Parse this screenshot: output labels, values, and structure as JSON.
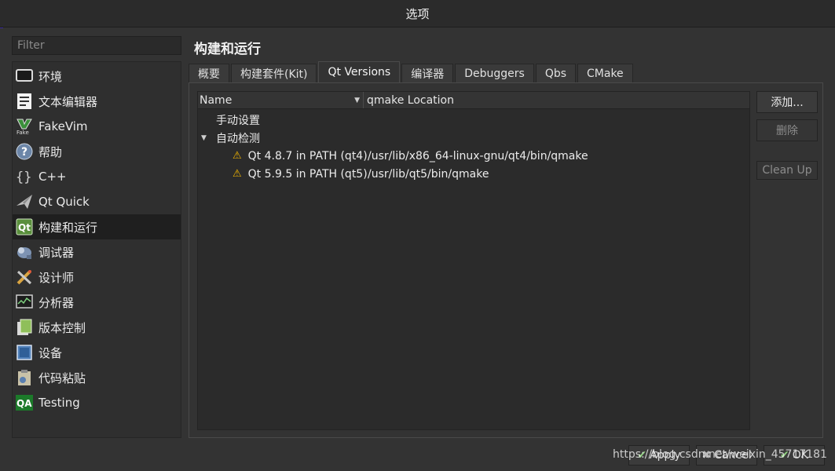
{
  "window": {
    "title": "选项"
  },
  "filter": {
    "placeholder": "Filter"
  },
  "sidebar": {
    "items": [
      {
        "label": "环境",
        "icon": "monitor-icon"
      },
      {
        "label": "文本编辑器",
        "icon": "text-editor-icon"
      },
      {
        "label": "FakeVim",
        "icon": "fakevim-icon"
      },
      {
        "label": "帮助",
        "icon": "help-icon"
      },
      {
        "label": "C++",
        "icon": "braces-icon"
      },
      {
        "label": "Qt Quick",
        "icon": "qt-quick-icon"
      },
      {
        "label": "构建和运行",
        "icon": "build-run-icon",
        "active": true
      },
      {
        "label": "调试器",
        "icon": "debugger-icon"
      },
      {
        "label": "设计师",
        "icon": "designer-icon"
      },
      {
        "label": "分析器",
        "icon": "analyzer-icon"
      },
      {
        "label": "版本控制",
        "icon": "version-control-icon"
      },
      {
        "label": "设备",
        "icon": "device-icon"
      },
      {
        "label": "代码粘贴",
        "icon": "code-paste-icon"
      },
      {
        "label": "Testing",
        "icon": "qa-icon"
      }
    ]
  },
  "main": {
    "title": "构建和运行",
    "tabs": [
      {
        "label": "概要"
      },
      {
        "label": "构建套件(Kit)"
      },
      {
        "label": "Qt Versions",
        "active": true
      },
      {
        "label": "编译器"
      },
      {
        "label": "Debuggers"
      },
      {
        "label": "Qbs"
      },
      {
        "label": "CMake"
      }
    ]
  },
  "tree": {
    "columns": {
      "name": "Name",
      "qmake": "qmake Location"
    },
    "groups": {
      "manual": "手动设置",
      "auto": "自动检测"
    },
    "rows": [
      {
        "name": "Qt 4.8.7 in PATH (qt4)",
        "path": "/usr/lib/x86_64-linux-gnu/qt4/bin/qmake"
      },
      {
        "name": "Qt 5.9.5 in PATH (qt5)",
        "path": "/usr/lib/qt5/bin/qmake"
      }
    ]
  },
  "buttons": {
    "add": "添加...",
    "remove": "删除",
    "cleanup": "Clean Up"
  },
  "dialog_buttons": {
    "apply": "Apply",
    "cancel": "Cancel",
    "ok": "OK"
  },
  "watermark": "https://blog.csdn.net/weixin_45717181",
  "colors": {
    "warning": "#f0b400",
    "qa": "#1c7a2a",
    "active_item": "#1f1f1f"
  }
}
